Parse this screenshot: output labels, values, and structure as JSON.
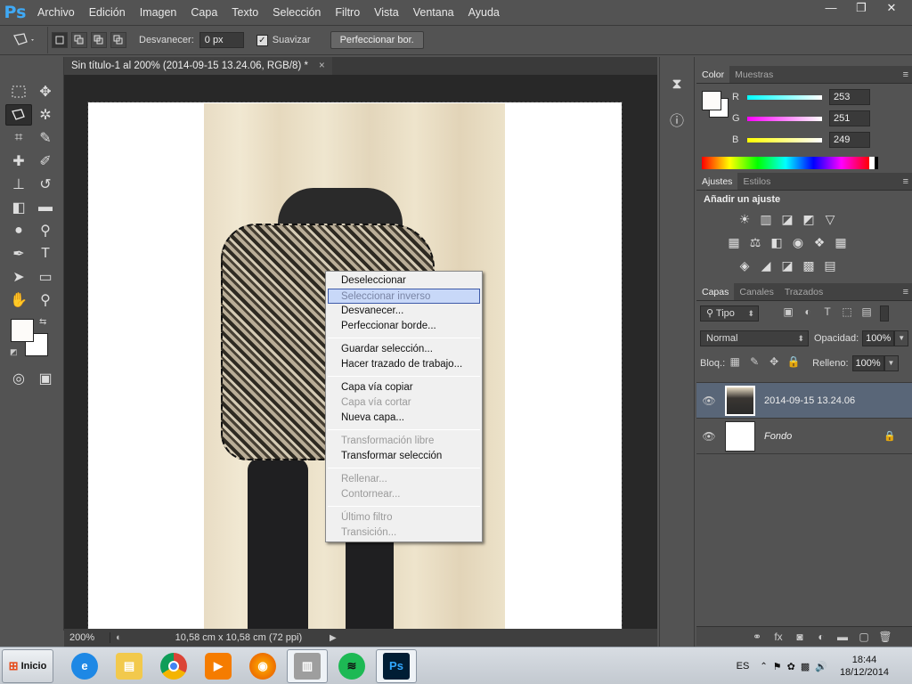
{
  "app": {
    "logo": "Ps",
    "menu": [
      "Archivo",
      "Edición",
      "Imagen",
      "Capa",
      "Texto",
      "Selección",
      "Filtro",
      "Vista",
      "Ventana",
      "Ayuda"
    ]
  },
  "window_controls": {
    "minimize": "—",
    "restore": "❐",
    "close": "✕"
  },
  "options": {
    "feather_label": "Desvanecer:",
    "feather_value": "0 px",
    "antialias_label": "Suavizar",
    "antialias_checked": true,
    "refine_button": "Perfeccionar bor."
  },
  "document": {
    "tab_title": "Sin título-1 al 200% (2014-09-15 13.24.06, RGB/8) *",
    "tab_close": "×",
    "zoom": "200%",
    "doc_info": "10,58 cm x 10,58 cm (72 ppi)"
  },
  "context_menu": {
    "groups": [
      [
        {
          "label": "Deseleccionar",
          "state": "normal"
        },
        {
          "label": "Seleccionar inverso",
          "state": "highlighted"
        },
        {
          "label": "Desvanecer...",
          "state": "normal"
        },
        {
          "label": "Perfeccionar borde...",
          "state": "normal"
        }
      ],
      [
        {
          "label": "Guardar selección...",
          "state": "normal"
        },
        {
          "label": "Hacer trazado de trabajo...",
          "state": "normal"
        }
      ],
      [
        {
          "label": "Capa vía copiar",
          "state": "normal"
        },
        {
          "label": "Capa vía cortar",
          "state": "disabled"
        },
        {
          "label": "Nueva capa...",
          "state": "normal"
        }
      ],
      [
        {
          "label": "Transformación libre",
          "state": "disabled"
        },
        {
          "label": "Transformar selección",
          "state": "normal"
        }
      ],
      [
        {
          "label": "Rellenar...",
          "state": "disabled"
        },
        {
          "label": "Contornear...",
          "state": "disabled"
        }
      ],
      [
        {
          "label": "Último filtro",
          "state": "disabled"
        },
        {
          "label": "Transición...",
          "state": "disabled"
        }
      ]
    ]
  },
  "color_panel": {
    "tabs": [
      "Color",
      "Muestras"
    ],
    "r_label": "R",
    "g_label": "G",
    "b_label": "B",
    "r": "253",
    "g": "251",
    "b": "249",
    "foreground": "#fdfbf9"
  },
  "adjustments_panel": {
    "tabs": [
      "Ajustes",
      "Estilos"
    ],
    "title": "Añadir un ajuste"
  },
  "layers_panel": {
    "tabs": [
      "Capas",
      "Canales",
      "Trazados"
    ],
    "filter": "Tipo",
    "blend_mode": "Normal",
    "opacity_label": "Opacidad:",
    "opacity": "100%",
    "lock_label": "Bloq.:",
    "fill_label": "Relleno:",
    "fill": "100%",
    "layers": [
      {
        "name": "2014-09-15 13.24.06",
        "selected": true
      },
      {
        "name": "Fondo",
        "selected": false,
        "locked": true
      }
    ]
  },
  "taskbar": {
    "start": "Inicio",
    "language": "ES",
    "time": "18:44",
    "date": "18/12/2014"
  }
}
